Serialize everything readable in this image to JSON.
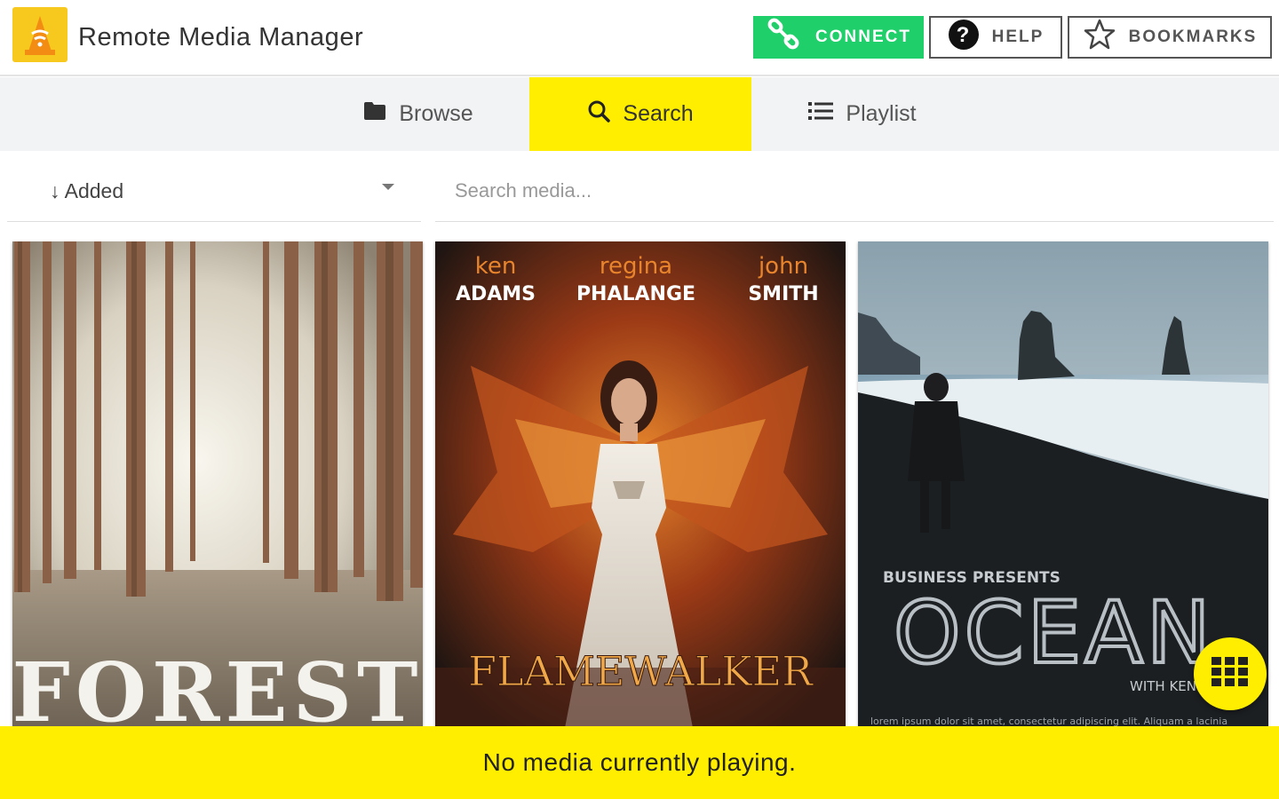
{
  "app": {
    "title": "Remote Media Manager"
  },
  "header": {
    "connect_label": "CONNECT",
    "help_label": "HELP",
    "bookmarks_label": "BOOKMARKS"
  },
  "tabs": [
    {
      "label": "Browse",
      "icon": "folder-icon",
      "active": false
    },
    {
      "label": "Search",
      "icon": "search-icon",
      "active": true
    },
    {
      "label": "Playlist",
      "icon": "list-icon",
      "active": false
    }
  ],
  "filters": {
    "sort_value": "↓ Added",
    "search_placeholder": "Search media..."
  },
  "media": [
    {
      "title": "FOREST"
    },
    {
      "title": "FLAMEWALKER",
      "credits": [
        {
          "first": "ken",
          "last": "ADAMS"
        },
        {
          "first": "regina",
          "last": "PHALANGE"
        },
        {
          "first": "john",
          "last": "SMITH"
        }
      ]
    },
    {
      "title": "OCEAN",
      "presenter": "BUSINESS PRESENTS",
      "credit": "WITH KEN",
      "tagline": "lorem ipsum dolor sit amet, consectetur adipiscing elit. Aliquam a lacinia"
    }
  ],
  "player": {
    "status": "No media currently playing."
  },
  "colors": {
    "accent": "#ffee00",
    "connect": "#1ecf6a",
    "logo": "#f7c81e"
  }
}
